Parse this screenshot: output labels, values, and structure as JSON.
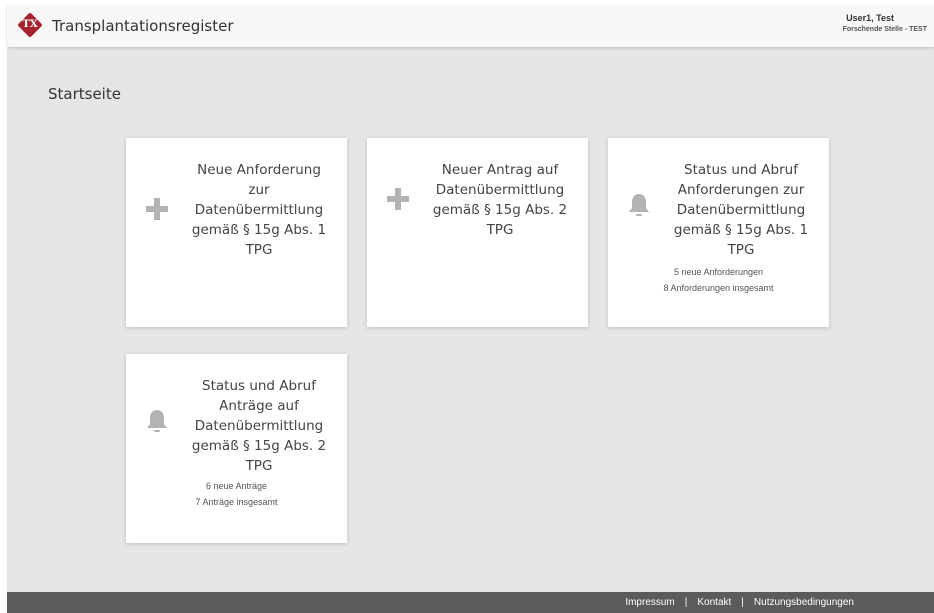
{
  "header": {
    "app_title": "Transplantationsregister",
    "logo_text": "TX",
    "user_name": "User1, Test",
    "user_role": "Forschende Stelle - TEST"
  },
  "page": {
    "title": "Startseite"
  },
  "cards": [
    {
      "icon": "plus-icon",
      "title": "Neue Anforderung zur Datenübermittlung gemäß § 15g Abs. 1 TPG",
      "lines": [
        "Neue Anforderung",
        "zur",
        "Datenübermittlung",
        "gemäß § 15g Abs. 1",
        "TPG"
      ]
    },
    {
      "icon": "plus-icon",
      "title": "Neuer Antrag auf Datenübermittlung gemäß § 15g Abs. 2 TPG",
      "lines": [
        "Neuer Antrag auf",
        "Datenübermittlung",
        "gemäß § 15g Abs. 2",
        "TPG"
      ]
    },
    {
      "icon": "bell-icon",
      "title": "Status und Abruf Anforderungen zur Datenübermittlung gemäß § 15g Abs. 1 TPG",
      "lines": [
        "Status und Abruf",
        "Anforderungen zur",
        "Datenübermittlung",
        "gemäß § 15g Abs. 1",
        "TPG"
      ],
      "info": [
        "5 neue Anforderungen",
        "8 Anforderungen insgesamt"
      ]
    },
    {
      "icon": "bell-icon",
      "title": "Status und Abruf Anträge auf Datenübermittlung gemäß § 15g Abs. 2 TPG",
      "lines": [
        "Status und Abruf",
        "Anträge auf",
        "Datenübermittlung",
        "gemäß § 15g Abs. 2",
        "TPG"
      ],
      "info": [
        "6 neue Anträge",
        "7 Anträge insgesamt"
      ]
    }
  ],
  "footer": {
    "links": [
      "Impressum",
      "Kontakt",
      "Nutzungsbedingungen"
    ],
    "separator": "|"
  },
  "colors": {
    "brand": "#a5232e",
    "background": "#e6e6e6",
    "header": "#f7f7f7",
    "footer": "#5b5b5b",
    "icon": "#b3b3b3"
  }
}
